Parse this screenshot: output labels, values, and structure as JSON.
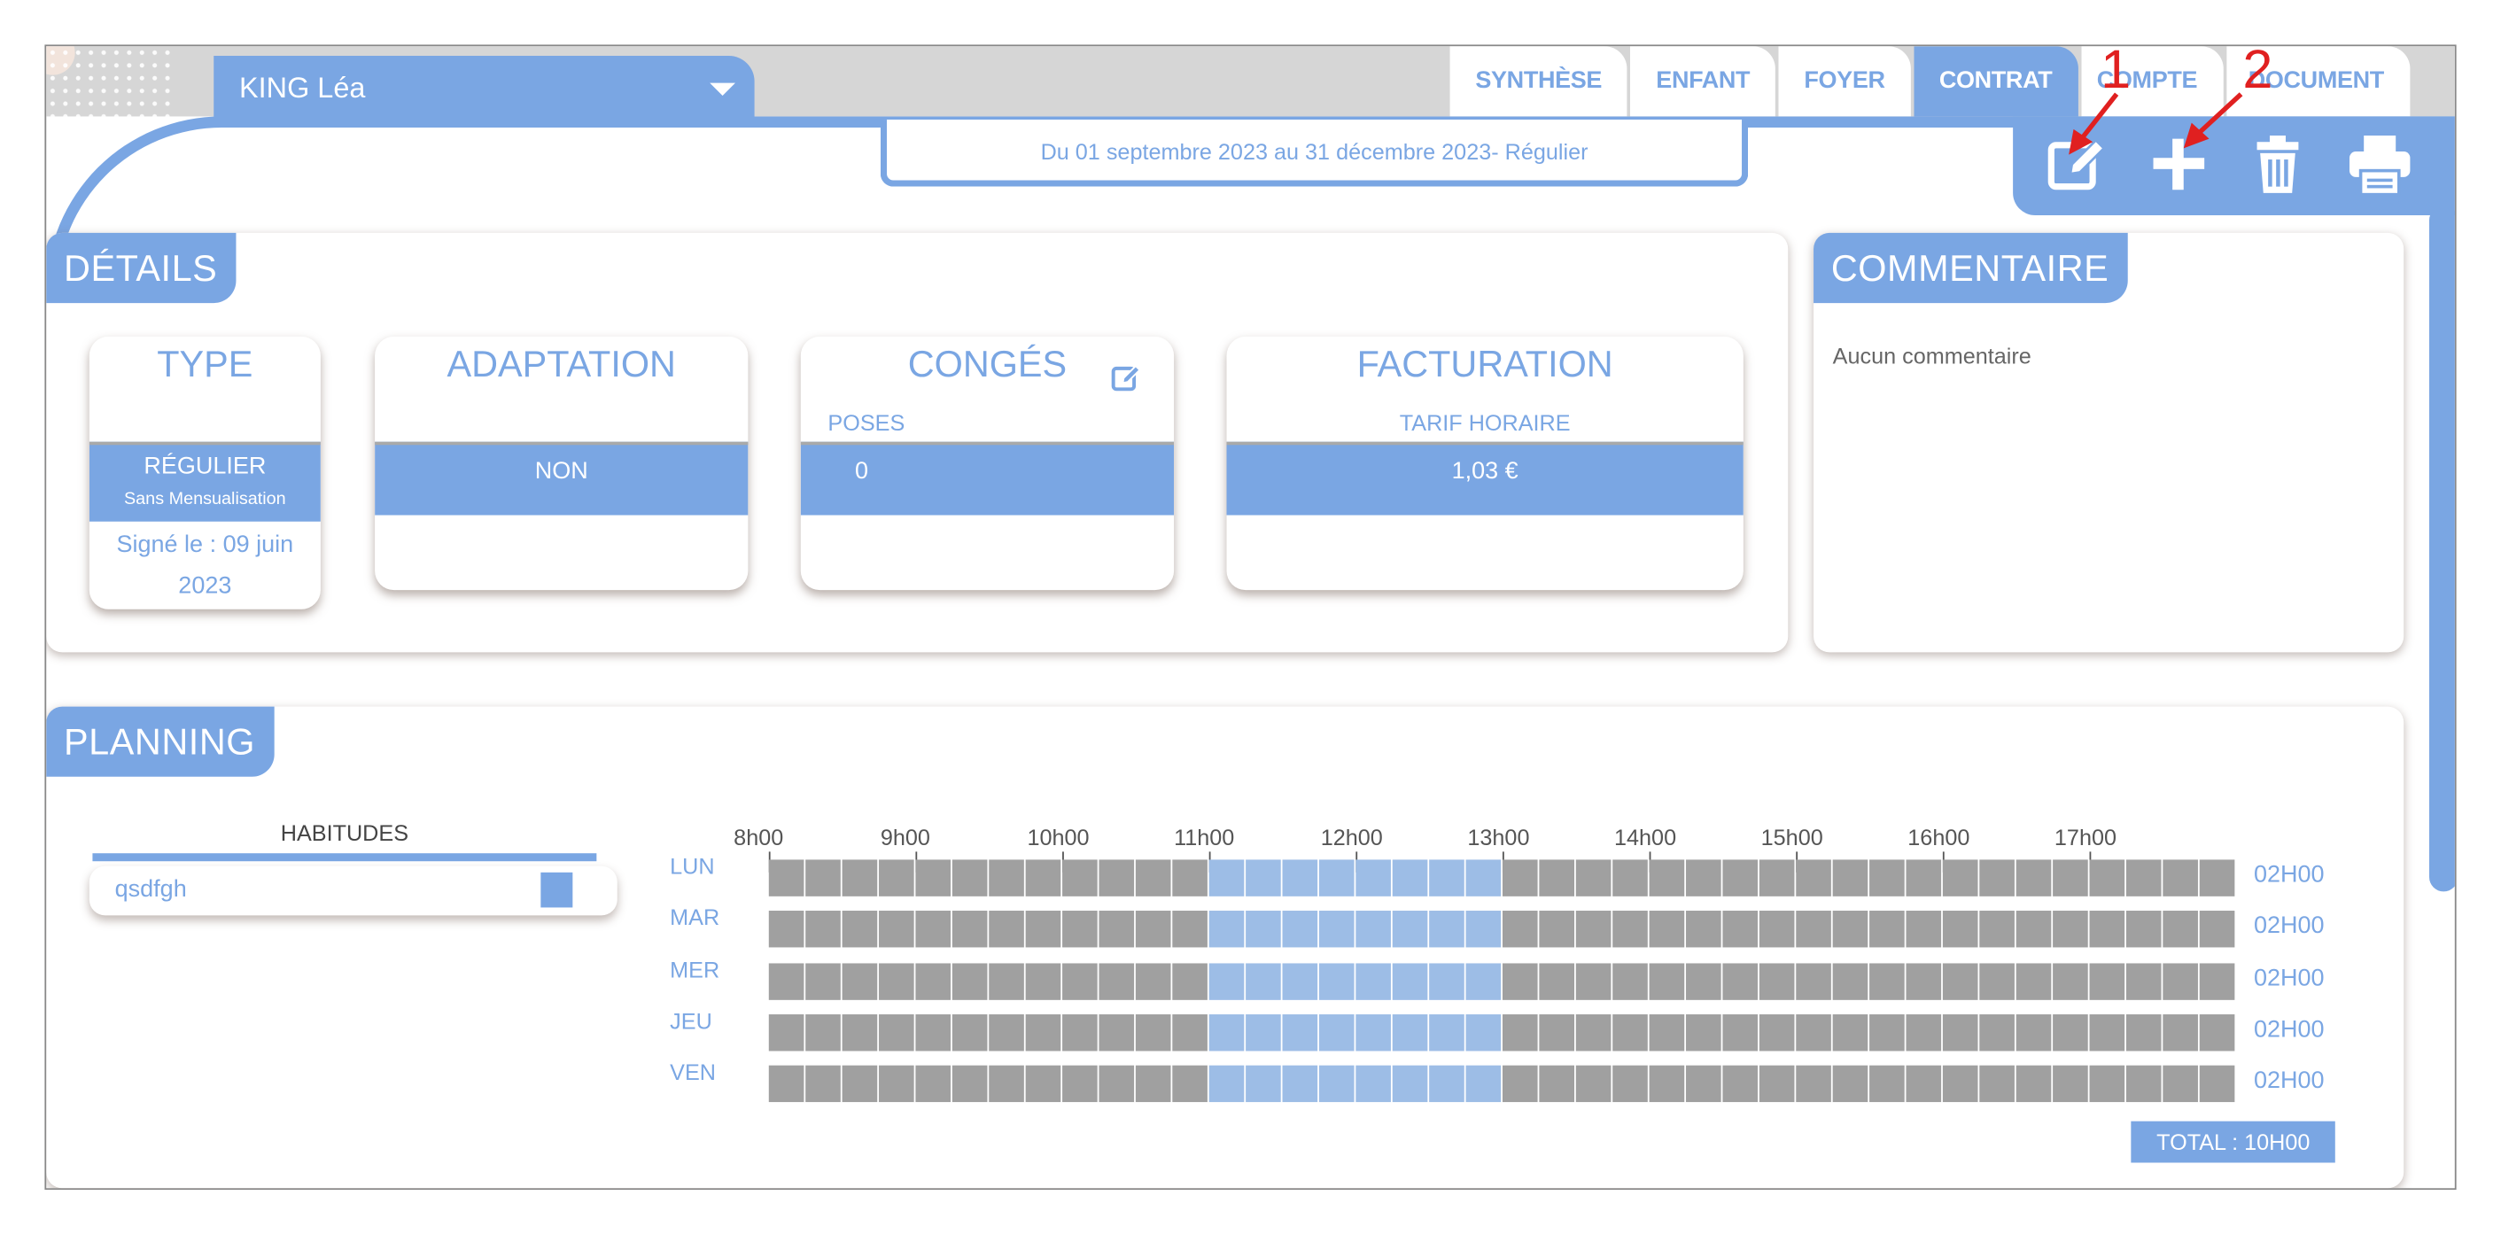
{
  "header": {
    "child_name": "KING Léa",
    "tabs": [
      {
        "label": "SYNTHÈSE",
        "active": false
      },
      {
        "label": "ENFANT",
        "active": false
      },
      {
        "label": "FOYER",
        "active": false
      },
      {
        "label": "CONTRAT",
        "active": true
      },
      {
        "label": "COMPTE",
        "active": false
      },
      {
        "label": "DOCUMENT",
        "active": false
      }
    ],
    "contract_period": "Du 01 septembre 2023 au 31 décembre 2023- Régulier"
  },
  "toolbar": {
    "icons": [
      "edit-icon",
      "add-icon",
      "trash-icon",
      "print-icon"
    ]
  },
  "annotations": {
    "one": "1",
    "two": "2"
  },
  "details": {
    "title": "DÉTAILS",
    "type": {
      "title": "TYPE",
      "value": "RÉGULIER",
      "subvalue": "Sans Mensualisation",
      "signed": "Signé le : 09 juin 2023"
    },
    "adaptation": {
      "title": "ADAPTATION",
      "value": "NON"
    },
    "conges": {
      "title": "CONGÉS",
      "sublabel": "POSES",
      "value": "0"
    },
    "facturation": {
      "title": "FACTURATION",
      "sublabel": "TARIF HORAIRE",
      "value": "1,03 €"
    }
  },
  "comment": {
    "title": "COMMENTAIRE",
    "text": "Aucun commentaire"
  },
  "planning": {
    "title": "PLANNING",
    "habits_header": "HABITUDES",
    "habits": [
      "qsdfgh"
    ],
    "hours": [
      "8h00",
      "9h00",
      "10h00",
      "11h00",
      "12h00",
      "13h00",
      "14h00",
      "15h00",
      "16h00",
      "17h00"
    ],
    "slots_per_hour": 4,
    "days": [
      {
        "label": "LUN",
        "active_from": "11h00",
        "active_to": "13h00",
        "total": "02H00"
      },
      {
        "label": "MAR",
        "active_from": "11h00",
        "active_to": "13h00",
        "total": "02H00"
      },
      {
        "label": "MER",
        "active_from": "11h00",
        "active_to": "13h00",
        "total": "02H00"
      },
      {
        "label": "JEU",
        "active_from": "11h00",
        "active_to": "13h00",
        "total": "02H00"
      },
      {
        "label": "VEN",
        "active_from": "11h00",
        "active_to": "13h00",
        "total": "02H00"
      }
    ],
    "total": "TOTAL : 10H00"
  },
  "colors": {
    "accent": "#7aa6e3",
    "slot_off": "#a0a0a0",
    "slot_on": "#9dbde6",
    "annotation": "#e02020"
  }
}
